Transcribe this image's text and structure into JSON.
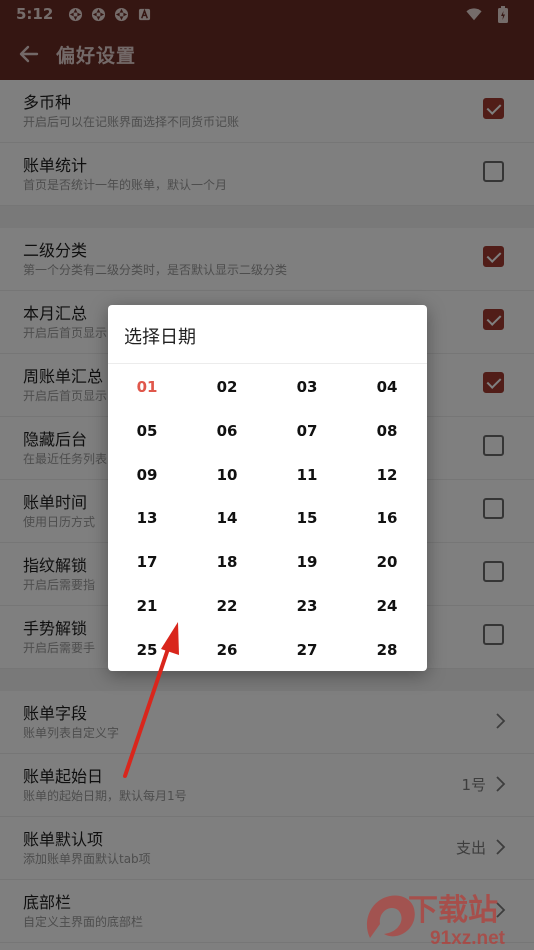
{
  "status_bar": {
    "time": "5:12"
  },
  "app_bar": {
    "title": "偏好设置"
  },
  "settings": [
    {
      "title": "多币种",
      "subtitle": "开启后可以在记账界面选择不同货币记账",
      "checked": true
    },
    {
      "title": "账单统计",
      "subtitle": "首页是否统计一年的账单，默认一个月",
      "checked": false
    },
    {
      "title": "二级分类",
      "subtitle": "第一个分类有二级分类时，是否默认显示二级分类",
      "checked": true
    },
    {
      "title": "本月汇总",
      "subtitle": "开启后首页显示",
      "checked": true
    },
    {
      "title": "周账单汇总",
      "subtitle": "开启后首页显示",
      "checked": true
    },
    {
      "title": "隐藏后台",
      "subtitle": "在最近任务列表",
      "checked": false
    },
    {
      "title": "账单时间",
      "subtitle": "使用日历方式",
      "checked": false
    },
    {
      "title": "指纹解锁",
      "subtitle": "开启后需要指",
      "checked": false
    },
    {
      "title": "手势解锁",
      "subtitle": "开启后需要手",
      "checked": false
    },
    {
      "title": "账单字段",
      "subtitle": "账单列表自定义字",
      "value": ""
    },
    {
      "title": "账单起始日",
      "subtitle": "账单的起始日期，默认每月1号",
      "value": "1号"
    },
    {
      "title": "账单默认项",
      "subtitle": "添加账单界面默认tab项",
      "value": "支出"
    },
    {
      "title": "底部栏",
      "subtitle": "自定义主界面的底部栏",
      "value": ""
    }
  ],
  "date_dialog": {
    "title": "选择日期",
    "selected": "01",
    "days": [
      "01",
      "02",
      "03",
      "04",
      "05",
      "06",
      "07",
      "08",
      "09",
      "10",
      "11",
      "12",
      "13",
      "14",
      "15",
      "16",
      "17",
      "18",
      "19",
      "20",
      "21",
      "22",
      "23",
      "24",
      "25",
      "26",
      "27",
      "28"
    ]
  },
  "colors": {
    "appbar": "#6b2c25",
    "accent": "#a23b31",
    "selected_day": "#e0574b",
    "annotation_arrow": "#d9261c"
  },
  "watermark": {
    "text": "下载站",
    "url_text": "91xz.net"
  }
}
